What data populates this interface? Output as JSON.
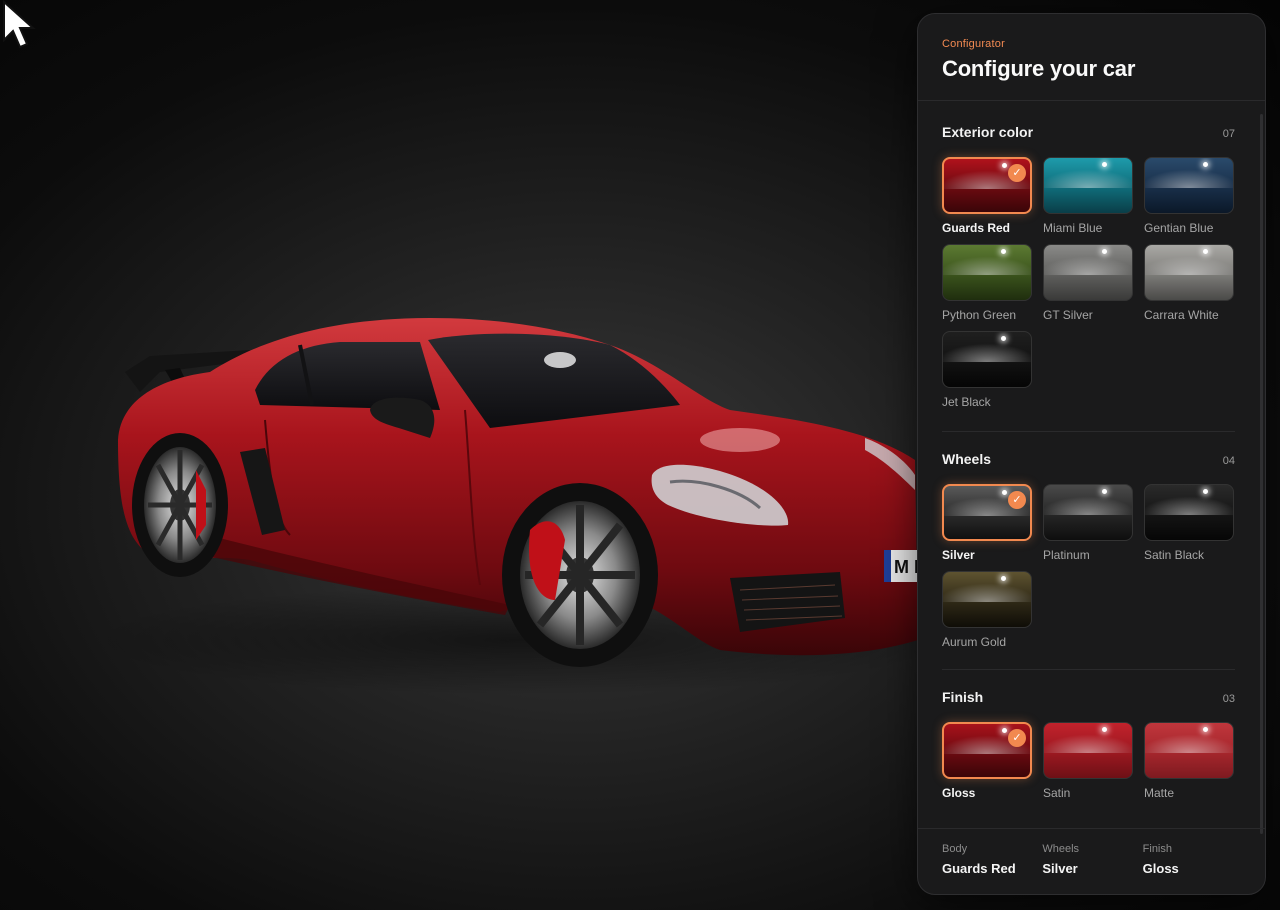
{
  "header": {
    "eyebrow": "Configurator",
    "title": "Configure your car"
  },
  "sections": [
    {
      "title": "Exterior color",
      "count": "07",
      "options": [
        {
          "label": "Guards Red",
          "selected": true,
          "colors": [
            "#b0121c",
            "#6a0a10",
            "#3a0508"
          ]
        },
        {
          "label": "Miami Blue",
          "selected": false,
          "colors": [
            "#1e9bab",
            "#0f6b78",
            "#0a3e48"
          ]
        },
        {
          "label": "Gentian Blue",
          "selected": false,
          "colors": [
            "#2a4a6b",
            "#182e48",
            "#0b1828"
          ]
        },
        {
          "label": "Python Green",
          "selected": false,
          "colors": [
            "#5c7a32",
            "#3a521c",
            "#1f2e0e"
          ]
        },
        {
          "label": "GT Silver",
          "selected": false,
          "colors": [
            "#8a8a88",
            "#5e5e5c",
            "#3a3a39"
          ]
        },
        {
          "label": "Carrara White",
          "selected": false,
          "colors": [
            "#a9a8a4",
            "#7b7a77",
            "#4a4a48"
          ]
        },
        {
          "label": "Jet Black",
          "selected": false,
          "colors": [
            "#1f1f1f",
            "#121212",
            "#050505"
          ]
        }
      ]
    },
    {
      "title": "Wheels",
      "count": "04",
      "options": [
        {
          "label": "Silver",
          "selected": true,
          "colors": [
            "#5a5a5a",
            "#2a2a2a",
            "#101010"
          ]
        },
        {
          "label": "Platinum",
          "selected": false,
          "colors": [
            "#4a4a4a",
            "#252525",
            "#0e0e0e"
          ]
        },
        {
          "label": "Satin Black",
          "selected": false,
          "colors": [
            "#2a2a2a",
            "#141414",
            "#060606"
          ]
        },
        {
          "label": "Aurum Gold",
          "selected": false,
          "colors": [
            "#5e5330",
            "#2e2816",
            "#0f0d07"
          ]
        }
      ]
    },
    {
      "title": "Finish",
      "count": "03",
      "options": [
        {
          "label": "Gloss",
          "selected": true,
          "colors": [
            "#a8121b",
            "#6a0a10",
            "#3a0508"
          ]
        },
        {
          "label": "Satin",
          "selected": false,
          "colors": [
            "#c2222c",
            "#9a1820",
            "#6e1016"
          ]
        },
        {
          "label": "Matte",
          "selected": false,
          "colors": [
            "#c0363c",
            "#a4262c",
            "#7e1a20"
          ]
        }
      ]
    }
  ],
  "summary": [
    {
      "key": "Body",
      "value": "Guards Red"
    },
    {
      "key": "Wheels",
      "value": "Silver"
    },
    {
      "key": "Finish",
      "value": "Gloss"
    }
  ],
  "plate_text": "M L",
  "accent_color": "#f2894f",
  "icons": {
    "check": "check-icon",
    "cursor": "cursor-arrow-icon"
  }
}
